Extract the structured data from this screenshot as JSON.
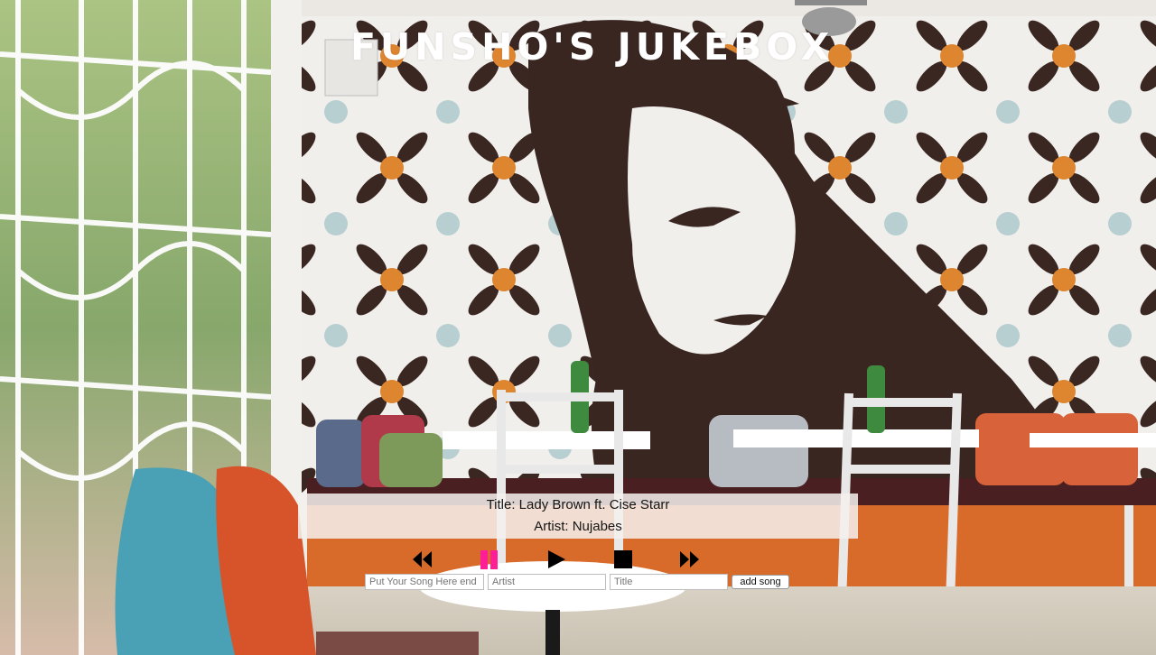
{
  "app": {
    "title": "FUNSHO'S JUKEBOX"
  },
  "now_playing": {
    "title_line": "Title: Lady Brown ft. Cise Starr",
    "artist_line": "Artist: Nujabes"
  },
  "controls": {
    "rewind_icon": "rewind-icon",
    "pause_icon": "pause-icon",
    "play_icon": "play-icon",
    "stop_icon": "stop-icon",
    "fast_forward_icon": "fast-forward-icon",
    "pause_color": "#ff1e96",
    "icon_color": "#000000"
  },
  "form": {
    "song_url_placeholder": "Put Your Song Here end",
    "artist_placeholder": "Artist",
    "title_placeholder": "Title",
    "add_button_label": "add song"
  }
}
